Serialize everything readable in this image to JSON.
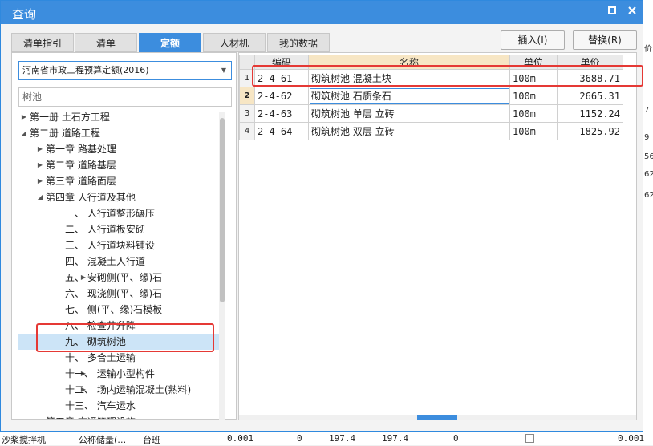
{
  "window": {
    "title": "查询"
  },
  "tabs": [
    {
      "label": "清单指引",
      "active": false
    },
    {
      "label": "清单",
      "active": false
    },
    {
      "label": "定额",
      "active": true
    },
    {
      "label": "人材机",
      "active": false
    },
    {
      "label": "我的数据",
      "active": false
    }
  ],
  "buttons": {
    "insert": "插入(I)",
    "replace": "替换(R)"
  },
  "library_select": {
    "value": "河南省市政工程预算定额(2016)"
  },
  "search": {
    "value": "树池"
  },
  "tree": [
    {
      "label": "第一册 土石方工程",
      "level": 0,
      "arrow": "right"
    },
    {
      "label": "第二册 道路工程",
      "level": 0,
      "arrow": "down"
    },
    {
      "label": "第一章 路基处理",
      "level": 1,
      "arrow": "right"
    },
    {
      "label": "第二章 道路基层",
      "level": 1,
      "arrow": "right"
    },
    {
      "label": "第三章 道路面层",
      "level": 1,
      "arrow": "right"
    },
    {
      "label": "第四章 人行道及其他",
      "level": 1,
      "arrow": "down"
    },
    {
      "label": "一、 人行道整形碾压",
      "level": 2,
      "arrow": ""
    },
    {
      "label": "二、 人行道板安砌",
      "level": 2,
      "arrow": ""
    },
    {
      "label": "三、 人行道块料铺设",
      "level": 2,
      "arrow": ""
    },
    {
      "label": "四、 混凝土人行道",
      "level": 2,
      "arrow": ""
    },
    {
      "label": "五、 安砌侧(平、缘)石",
      "level": 2,
      "arrow": "right"
    },
    {
      "label": "六、 现浇侧(平、缘)石",
      "level": 2,
      "arrow": ""
    },
    {
      "label": "七、 侧(平、缘)石模板",
      "level": 2,
      "arrow": ""
    },
    {
      "label": "八、 检查井升降",
      "level": 2,
      "arrow": ""
    },
    {
      "label": "九、 砌筑树池",
      "level": 2,
      "arrow": "",
      "selected": true
    },
    {
      "label": "十、 多合土运输",
      "level": 2,
      "arrow": ""
    },
    {
      "label": "十一、 运输小型构件",
      "level": 2,
      "arrow": "right"
    },
    {
      "label": "十二、 场内运输混凝土(熟料)",
      "level": 2,
      "arrow": "right"
    },
    {
      "label": "十三、 汽车运水",
      "level": 2,
      "arrow": ""
    },
    {
      "label": "第五章 交通管理设施",
      "level": 1,
      "arrow": ""
    }
  ],
  "table": {
    "headers": {
      "code": "编码",
      "name": "名称",
      "unit": "单位",
      "price": "单价"
    },
    "rows": [
      {
        "num": "1",
        "code": "2-4-61",
        "name": "砌筑树池 混凝土块",
        "unit": "100m",
        "price": "3688.71"
      },
      {
        "num": "2",
        "code": "2-4-62",
        "name": "砌筑树池 石质条石",
        "unit": "100m",
        "price": "2665.31"
      },
      {
        "num": "3",
        "code": "2-4-63",
        "name": "砌筑树池 单层 立砖",
        "unit": "100m",
        "price": "1152.24"
      },
      {
        "num": "4",
        "code": "2-4-64",
        "name": "砌筑树池 双层 立砖",
        "unit": "100m",
        "price": "1825.92"
      }
    ]
  },
  "background": {
    "bottom_row": [
      "沙浆搅拌机",
      "公称储量(…",
      "台班",
      "0.001",
      "0",
      "197.4",
      "197.4",
      "0",
      "0.001"
    ],
    "right_edge": [
      "价",
      "7",
      "9",
      "56",
      "62",
      "62"
    ]
  },
  "colors": {
    "accent": "#3c8dde",
    "highlight": "#e53935"
  }
}
